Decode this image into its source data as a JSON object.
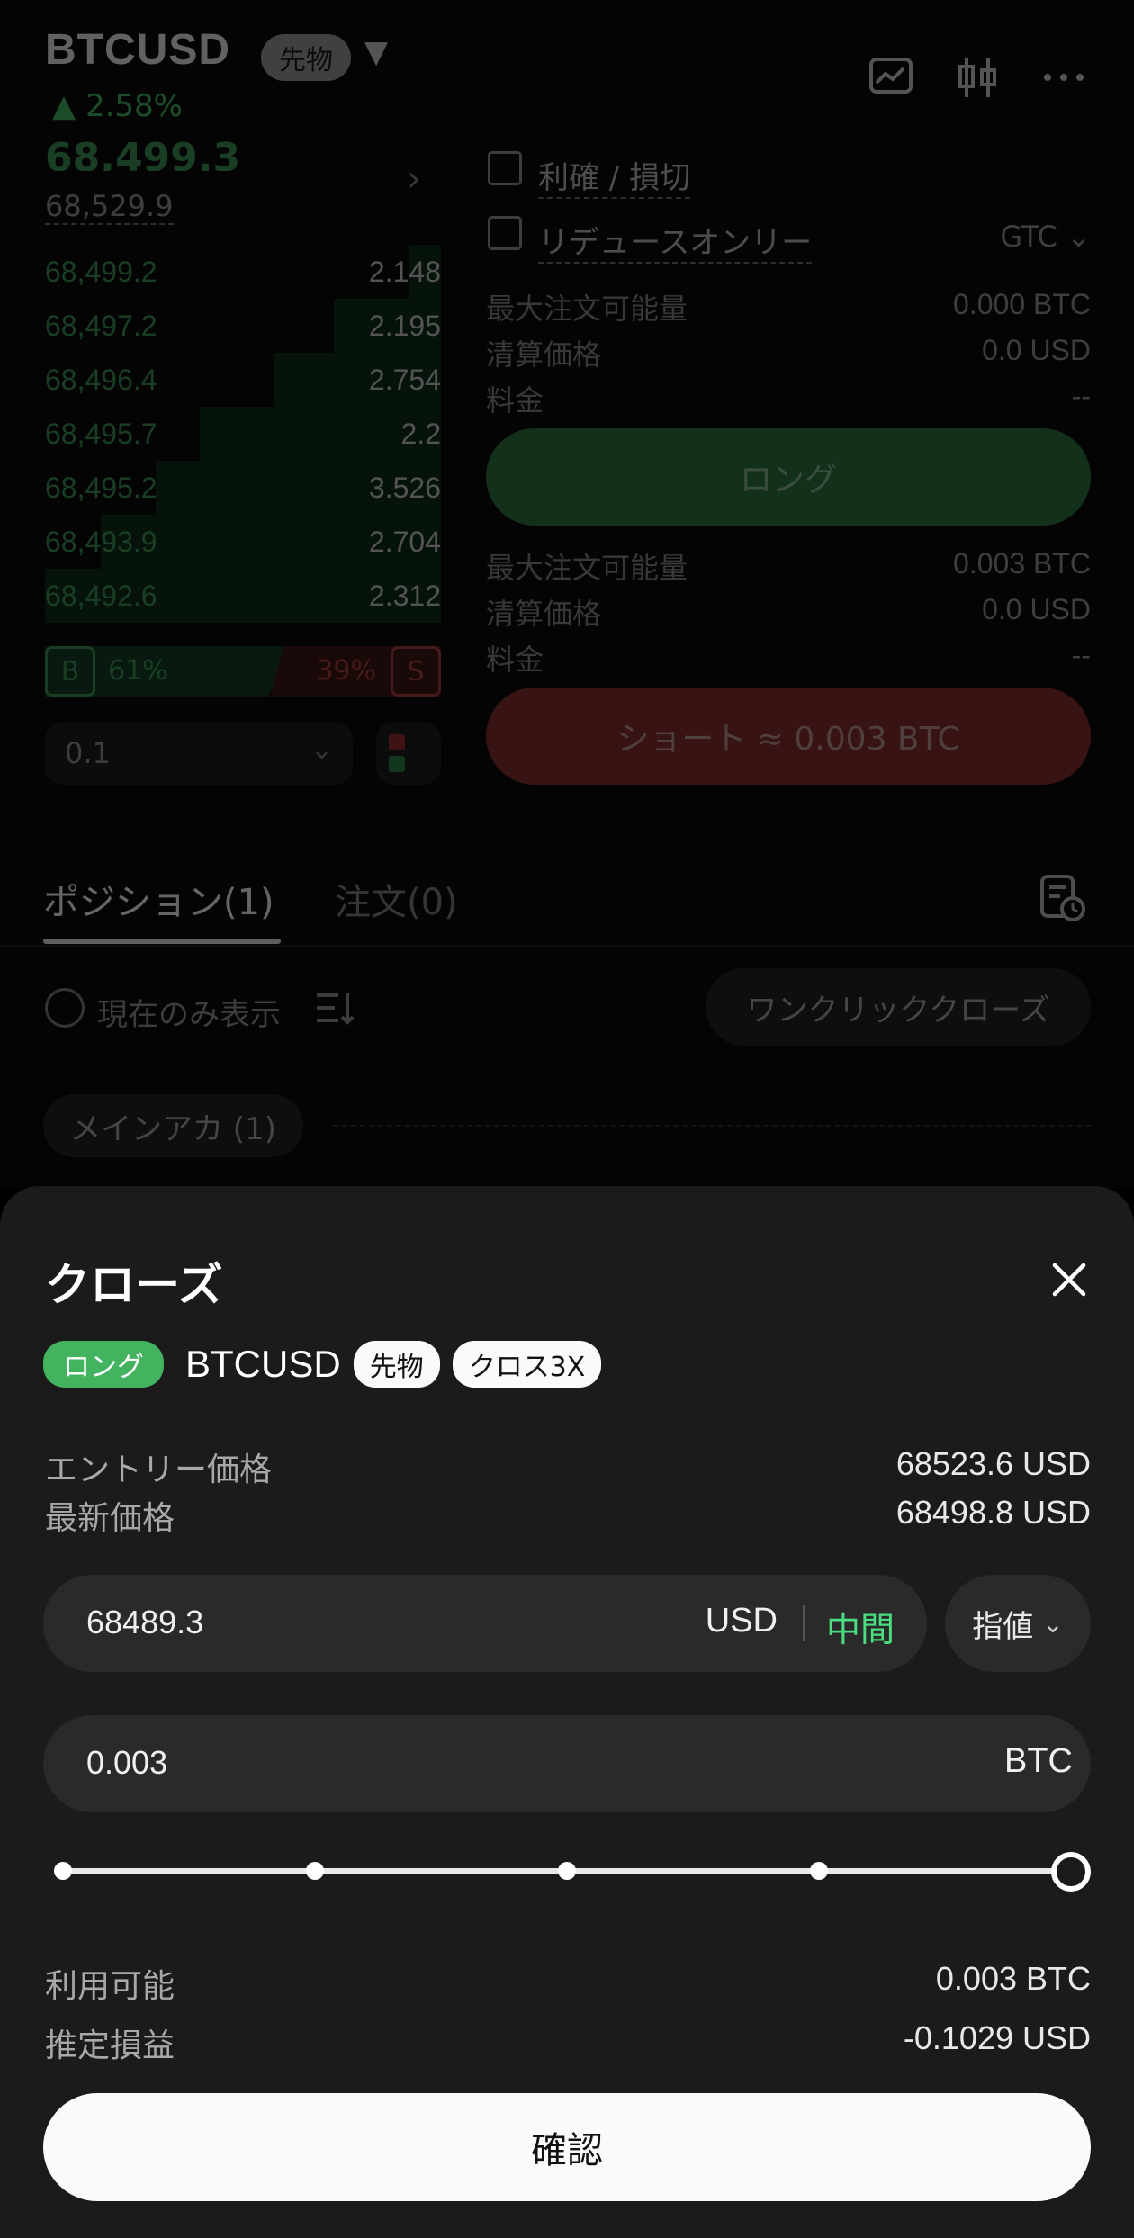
{
  "header": {
    "symbol": "BTCUSD",
    "type_badge": "先物",
    "caret": "▼",
    "change": "▲ 2.58%"
  },
  "orderbook": {
    "last_price": "68,499.3",
    "mark_price": "68,529.9",
    "bids": [
      {
        "price": "68,499.2",
        "qty": "2.148",
        "depth": 0.08
      },
      {
        "price": "68,497.2",
        "qty": "2.195",
        "depth": 0.27
      },
      {
        "price": "68,496.4",
        "qty": "2.754",
        "depth": 0.42
      },
      {
        "price": "68,495.7",
        "qty": "2.2",
        "depth": 0.61
      },
      {
        "price": "68,495.2",
        "qty": "3.526",
        "depth": 0.72
      },
      {
        "price": "68,493.9",
        "qty": "2.704",
        "depth": 0.86
      },
      {
        "price": "68,492.6",
        "qty": "2.312",
        "depth": 1.0
      }
    ],
    "buy_label": "B",
    "buy_pct": "61%",
    "sell_pct": "39%",
    "sell_label": "S",
    "precision": "0.1"
  },
  "order_form": {
    "tpsl_label": "利確 / 損切",
    "reduce_only_label": "リデュースオンリー",
    "tif": "GTC",
    "long_block": [
      {
        "label": "最大注文可能量",
        "value": "0.000 BTC"
      },
      {
        "label": "清算価格",
        "value": "0.0 USD"
      },
      {
        "label": "料金",
        "value": "--"
      }
    ],
    "long_button": "ロング",
    "short_block": [
      {
        "label": "最大注文可能量",
        "value": "0.003 BTC"
      },
      {
        "label": "清算価格",
        "value": "0.0 USD"
      },
      {
        "label": "料金",
        "value": "--"
      }
    ],
    "short_button": "ショート ≈ 0.003 BTC"
  },
  "tabs": {
    "positions": "ポジション(1)",
    "orders": "注文(0)"
  },
  "positions": {
    "show_current_only": "現在のみ表示",
    "one_click_close": "ワンクリッククローズ",
    "account_chip": "メインアカ (1)"
  },
  "sheet": {
    "title": "クローズ",
    "side_badge": "ロング",
    "symbol": "BTCUSD",
    "type_badge": "先物",
    "margin_badge": "クロス3X",
    "entry_label": "エントリー価格",
    "entry_value": "68523.6 USD",
    "latest_label": "最新価格",
    "latest_value": "68498.8 USD",
    "price_value": "68489.3",
    "price_unit": "USD",
    "mid_label": "中間",
    "order_type": "指値",
    "qty_value": "0.003",
    "qty_unit": "BTC",
    "slider_fraction": 1.0,
    "available_label": "利用可能",
    "available_value": "0.003 BTC",
    "pnl_label": "推定損益",
    "pnl_value": "-0.1029 USD",
    "confirm_label": "確認"
  },
  "colors": {
    "long_green": "#44b35f",
    "short_red": "#c0392b",
    "mid_green": "#4ade80"
  }
}
